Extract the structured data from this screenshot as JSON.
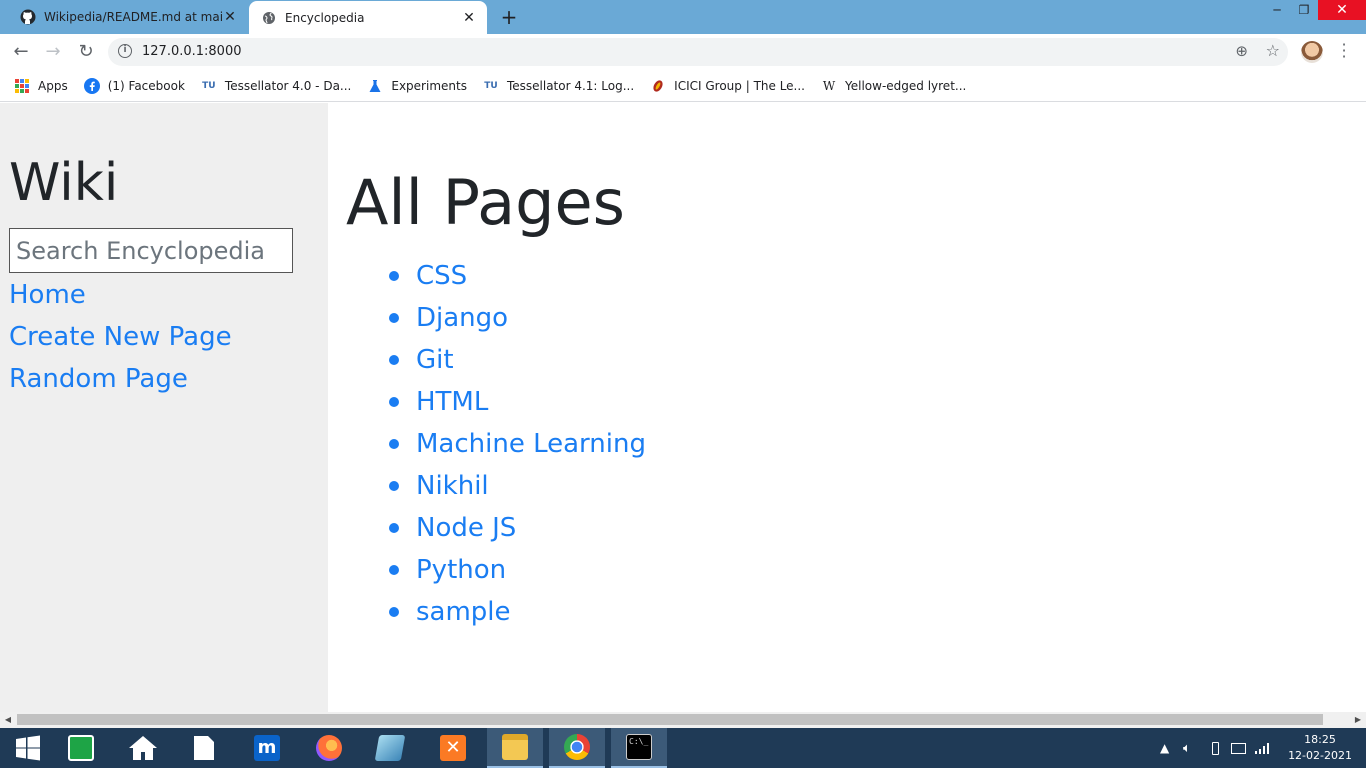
{
  "browser": {
    "tabs": [
      {
        "title": "Wikipedia/README.md at main ·",
        "icon": "github-icon",
        "active": false
      },
      {
        "title": "Encyclopedia",
        "icon": "globe-icon",
        "active": true
      }
    ],
    "new_tab": "+",
    "url": "127.0.0.1:8000",
    "bookmarks": [
      {
        "label": "Apps",
        "icon": "apps-grid-icon"
      },
      {
        "label": "(1) Facebook",
        "icon": "facebook-icon"
      },
      {
        "label": "Tessellator 4.0 - Da...",
        "icon": "tessellator-icon"
      },
      {
        "label": "Experiments",
        "icon": "flask-icon"
      },
      {
        "label": "Tessellator 4.1: Log...",
        "icon": "tessellator-icon"
      },
      {
        "label": "ICICI Group | The Le...",
        "icon": "icici-icon"
      },
      {
        "label": "Yellow-edged lyret...",
        "icon": "wikipedia-icon"
      }
    ]
  },
  "sidebar": {
    "brand": "Wiki",
    "search_placeholder": "Search Encyclopedia",
    "links": [
      "Home",
      "Create New Page",
      "Random Page"
    ]
  },
  "main": {
    "heading": "All Pages",
    "entries": [
      "CSS",
      "Django",
      "Git",
      "HTML",
      "Machine Learning",
      "Nikhil",
      "Node JS",
      "Python",
      "sample"
    ]
  },
  "taskbar": {
    "time": "18:25",
    "date": "12-02-2021"
  },
  "colors": {
    "link": "#1a7df2",
    "sidebar_bg": "#efefef",
    "titlebar": "#6aa9d6",
    "taskbar": "#1f3a56"
  }
}
